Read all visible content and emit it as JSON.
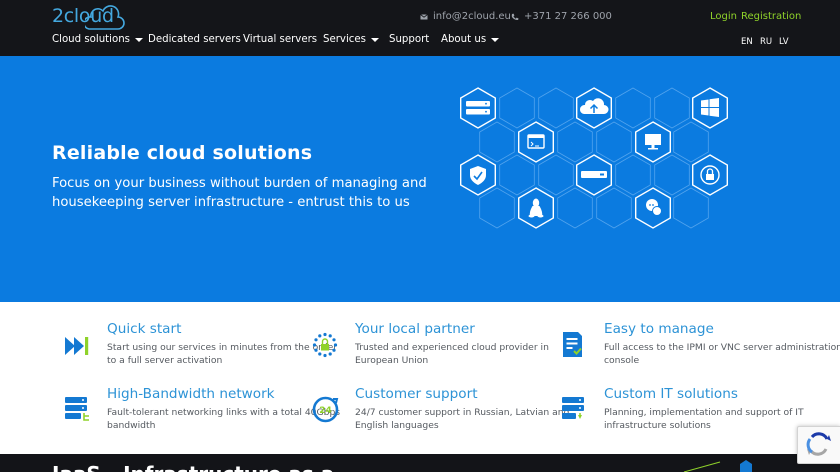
{
  "header": {
    "logo_text": "2cloud",
    "email": "info@2cloud.eu",
    "phone": "+371 27 266 000",
    "login_label": "Login",
    "register_label": "Registration"
  },
  "nav": {
    "items": [
      {
        "label": "Cloud solutions",
        "dropdown": true
      },
      {
        "label": "Dedicated servers",
        "dropdown": false
      },
      {
        "label": "Virtual servers",
        "dropdown": false
      },
      {
        "label": "Services",
        "dropdown": true
      },
      {
        "label": "Support",
        "dropdown": false
      },
      {
        "label": "About us",
        "dropdown": true
      }
    ],
    "languages": [
      "EN",
      "RU",
      "LV"
    ]
  },
  "hero": {
    "title": "Reliable cloud solutions",
    "subtitle": "Focus on your business without burden of managing and housekeeping server infrastructure - entrust this to us",
    "icons": [
      "server-icon",
      "cloud-upload-icon",
      "windows-icon",
      "browser-window-icon",
      "monitor-icon",
      "shield-icon",
      "rack-unit-icon",
      "lock-icon",
      "linux-icon",
      "chat-icon"
    ]
  },
  "features": [
    {
      "title": "Quick start",
      "desc": "Start using our services in minutes from the order to a full server activation",
      "icon": "fast-forward-icon"
    },
    {
      "title": "Your local partner",
      "desc": "Trusted and experienced cloud provider in European Union",
      "icon": "eu-lock-icon"
    },
    {
      "title": "Easy to manage",
      "desc": "Full access to the IPMI or VNC server administration console",
      "icon": "document-check-icon"
    },
    {
      "title": "High-Bandwidth network",
      "desc": "Fault-tolerant networking links with a total 40Gbps bandwidth",
      "icon": "server-network-icon"
    },
    {
      "title": "Customer support",
      "desc": "24/7 customer support in Russian, Latvian and English languages",
      "icon": "support-24-icon"
    },
    {
      "title": "Custom IT solutions",
      "desc": "Planning, implementation and support of IT infrastructure solutions",
      "icon": "server-custom-icon"
    }
  ],
  "band": {
    "title": "IaaS - Infrastructure as a"
  },
  "colors": {
    "header_bg": "#141519",
    "hero_bg": "#0b7be0",
    "accent_blue": "#2d93d6",
    "accent_green": "#8fd22a"
  }
}
